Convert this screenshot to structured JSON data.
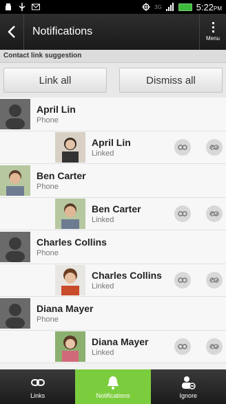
{
  "status_bar": {
    "time": "5:22",
    "time_suffix": "PM",
    "network_label": "3G"
  },
  "header": {
    "title": "Notifications",
    "menu_label": "Menu"
  },
  "section": {
    "title": "Contact link suggestion"
  },
  "actions": {
    "link_all": "Link all",
    "dismiss_all": "Dismiss all"
  },
  "contacts": [
    {
      "name": "April Lin",
      "source": "Phone",
      "linked_name": "April Lin",
      "linked_status": "Linked"
    },
    {
      "name": "Ben Carter",
      "source": "Phone",
      "linked_name": "Ben Carter",
      "linked_status": "Linked"
    },
    {
      "name": "Charles Collins",
      "source": "Phone",
      "linked_name": "Charles Collins",
      "linked_status": "Linked"
    },
    {
      "name": "Diana Mayer",
      "source": "Phone",
      "linked_name": "Diana Mayer",
      "linked_status": "Linked"
    }
  ],
  "tabs": [
    {
      "label": "Links"
    },
    {
      "label": "Notifications"
    },
    {
      "label": "Ignore"
    }
  ],
  "colors": {
    "accent": "#7ccd3e",
    "header_bg": "#1f1f1f"
  }
}
